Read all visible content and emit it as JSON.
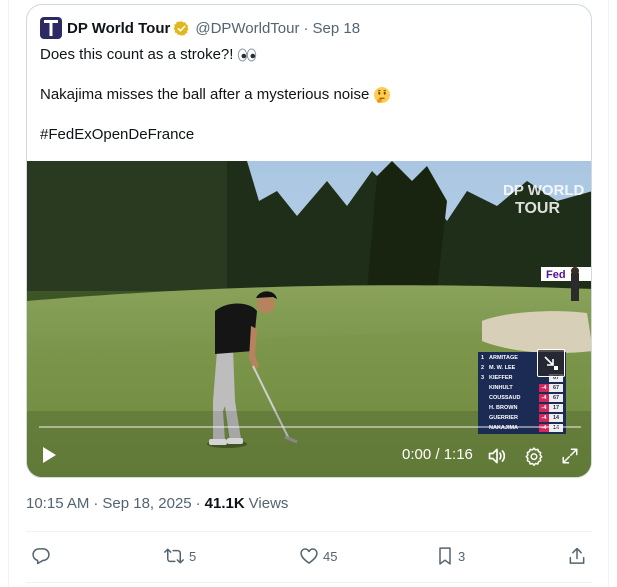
{
  "quoted_tweet": {
    "display_name": "DP World Tour",
    "handle": "@DPWorldTour",
    "date": "Sep 18",
    "lines": [
      "Does this count as a stroke?!",
      "Nakajima misses the ball after a mysterious noise",
      "#FedExOpenDeFrance"
    ],
    "emoji_line1": "eyes-emoji",
    "emoji_line2": "thinking-face-emoji"
  },
  "video": {
    "watermark": "DP WORLD TOUR",
    "time_display": "0:00 / 1:16",
    "progress": 0,
    "scoreboard": [
      {
        "pos": "1",
        "name": "ARMITAGE",
        "score": "",
        "hole": ""
      },
      {
        "pos": "2",
        "name": "M. W. LEE",
        "score": "",
        "hole": ""
      },
      {
        "pos": "3",
        "name": "KIEFFER",
        "score": "",
        "hole": "67"
      },
      {
        "pos": "",
        "name": "KINHULT",
        "score": "-4",
        "hole": "67"
      },
      {
        "pos": "",
        "name": "COUSSAUD",
        "score": "-4",
        "hole": "67"
      },
      {
        "pos": "",
        "name": "H. BROWN",
        "score": "-4",
        "hole": "17"
      },
      {
        "pos": "",
        "name": "GUERRIER",
        "score": "-4",
        "hole": "14"
      },
      {
        "pos": "",
        "name": "NAKAJIMA",
        "score": "-4",
        "hole": "14"
      }
    ]
  },
  "tweet_meta": {
    "time": "10:15 AM",
    "separator": "·",
    "date": "Sep 18, 2025",
    "views_count": "41.1K",
    "views_label": "Views"
  },
  "actions": {
    "replies": "",
    "retweets": "5",
    "likes": "45",
    "bookmarks": "3"
  },
  "colors": {
    "text_primary": "#0f1419",
    "text_secondary": "#536471",
    "border": "#cfd9de",
    "verified_gold": "#e2b719",
    "scoreboard_navy": "#1c2b53",
    "score_pink": "#d3265d"
  }
}
